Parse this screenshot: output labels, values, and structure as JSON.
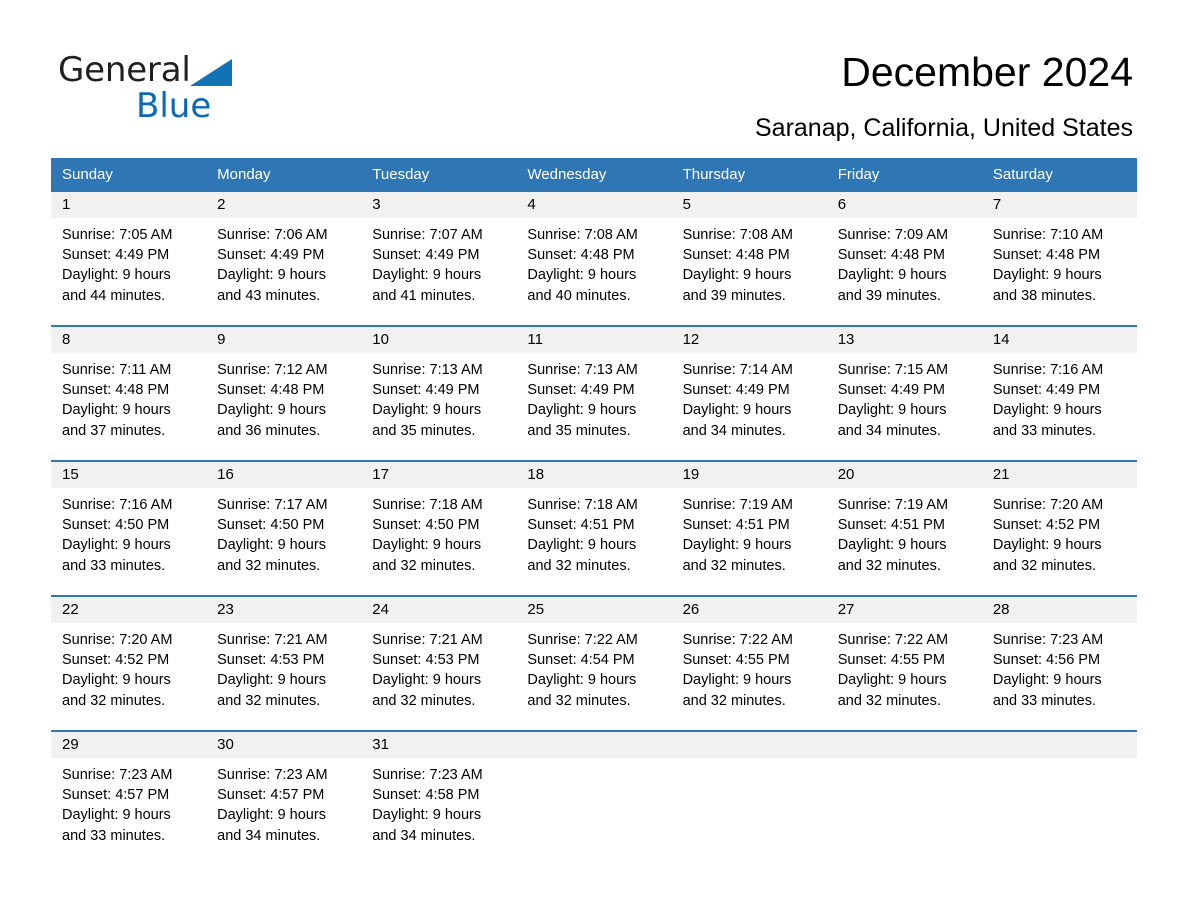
{
  "brand": {
    "name_part1": "General",
    "name_part2": "Blue",
    "triangle_color": "#1272b6",
    "blue_color": "#0b6ab5"
  },
  "header": {
    "title": "December 2024",
    "subtitle": "Saranap, California, United States"
  },
  "theme": {
    "header_blue": "#2f76b5",
    "date_band_gray": "#f1f1f1",
    "row_rule_blue": "#2f76b5",
    "text_black": "#000000",
    "header_text_white": "#ffffff"
  },
  "weekdays": [
    "Sunday",
    "Monday",
    "Tuesday",
    "Wednesday",
    "Thursday",
    "Friday",
    "Saturday"
  ],
  "weeks": [
    [
      {
        "date": "1",
        "sunrise": "Sunrise: 7:05 AM",
        "sunset": "Sunset: 4:49 PM",
        "daylight_line1": "Daylight: 9 hours",
        "daylight_line2": "and 44 minutes."
      },
      {
        "date": "2",
        "sunrise": "Sunrise: 7:06 AM",
        "sunset": "Sunset: 4:49 PM",
        "daylight_line1": "Daylight: 9 hours",
        "daylight_line2": "and 43 minutes."
      },
      {
        "date": "3",
        "sunrise": "Sunrise: 7:07 AM",
        "sunset": "Sunset: 4:49 PM",
        "daylight_line1": "Daylight: 9 hours",
        "daylight_line2": "and 41 minutes."
      },
      {
        "date": "4",
        "sunrise": "Sunrise: 7:08 AM",
        "sunset": "Sunset: 4:48 PM",
        "daylight_line1": "Daylight: 9 hours",
        "daylight_line2": "and 40 minutes."
      },
      {
        "date": "5",
        "sunrise": "Sunrise: 7:08 AM",
        "sunset": "Sunset: 4:48 PM",
        "daylight_line1": "Daylight: 9 hours",
        "daylight_line2": "and 39 minutes."
      },
      {
        "date": "6",
        "sunrise": "Sunrise: 7:09 AM",
        "sunset": "Sunset: 4:48 PM",
        "daylight_line1": "Daylight: 9 hours",
        "daylight_line2": "and 39 minutes."
      },
      {
        "date": "7",
        "sunrise": "Sunrise: 7:10 AM",
        "sunset": "Sunset: 4:48 PM",
        "daylight_line1": "Daylight: 9 hours",
        "daylight_line2": "and 38 minutes."
      }
    ],
    [
      {
        "date": "8",
        "sunrise": "Sunrise: 7:11 AM",
        "sunset": "Sunset: 4:48 PM",
        "daylight_line1": "Daylight: 9 hours",
        "daylight_line2": "and 37 minutes."
      },
      {
        "date": "9",
        "sunrise": "Sunrise: 7:12 AM",
        "sunset": "Sunset: 4:48 PM",
        "daylight_line1": "Daylight: 9 hours",
        "daylight_line2": "and 36 minutes."
      },
      {
        "date": "10",
        "sunrise": "Sunrise: 7:13 AM",
        "sunset": "Sunset: 4:49 PM",
        "daylight_line1": "Daylight: 9 hours",
        "daylight_line2": "and 35 minutes."
      },
      {
        "date": "11",
        "sunrise": "Sunrise: 7:13 AM",
        "sunset": "Sunset: 4:49 PM",
        "daylight_line1": "Daylight: 9 hours",
        "daylight_line2": "and 35 minutes."
      },
      {
        "date": "12",
        "sunrise": "Sunrise: 7:14 AM",
        "sunset": "Sunset: 4:49 PM",
        "daylight_line1": "Daylight: 9 hours",
        "daylight_line2": "and 34 minutes."
      },
      {
        "date": "13",
        "sunrise": "Sunrise: 7:15 AM",
        "sunset": "Sunset: 4:49 PM",
        "daylight_line1": "Daylight: 9 hours",
        "daylight_line2": "and 34 minutes."
      },
      {
        "date": "14",
        "sunrise": "Sunrise: 7:16 AM",
        "sunset": "Sunset: 4:49 PM",
        "daylight_line1": "Daylight: 9 hours",
        "daylight_line2": "and 33 minutes."
      }
    ],
    [
      {
        "date": "15",
        "sunrise": "Sunrise: 7:16 AM",
        "sunset": "Sunset: 4:50 PM",
        "daylight_line1": "Daylight: 9 hours",
        "daylight_line2": "and 33 minutes."
      },
      {
        "date": "16",
        "sunrise": "Sunrise: 7:17 AM",
        "sunset": "Sunset: 4:50 PM",
        "daylight_line1": "Daylight: 9 hours",
        "daylight_line2": "and 32 minutes."
      },
      {
        "date": "17",
        "sunrise": "Sunrise: 7:18 AM",
        "sunset": "Sunset: 4:50 PM",
        "daylight_line1": "Daylight: 9 hours",
        "daylight_line2": "and 32 minutes."
      },
      {
        "date": "18",
        "sunrise": "Sunrise: 7:18 AM",
        "sunset": "Sunset: 4:51 PM",
        "daylight_line1": "Daylight: 9 hours",
        "daylight_line2": "and 32 minutes."
      },
      {
        "date": "19",
        "sunrise": "Sunrise: 7:19 AM",
        "sunset": "Sunset: 4:51 PM",
        "daylight_line1": "Daylight: 9 hours",
        "daylight_line2": "and 32 minutes."
      },
      {
        "date": "20",
        "sunrise": "Sunrise: 7:19 AM",
        "sunset": "Sunset: 4:51 PM",
        "daylight_line1": "Daylight: 9 hours",
        "daylight_line2": "and 32 minutes."
      },
      {
        "date": "21",
        "sunrise": "Sunrise: 7:20 AM",
        "sunset": "Sunset: 4:52 PM",
        "daylight_line1": "Daylight: 9 hours",
        "daylight_line2": "and 32 minutes."
      }
    ],
    [
      {
        "date": "22",
        "sunrise": "Sunrise: 7:20 AM",
        "sunset": "Sunset: 4:52 PM",
        "daylight_line1": "Daylight: 9 hours",
        "daylight_line2": "and 32 minutes."
      },
      {
        "date": "23",
        "sunrise": "Sunrise: 7:21 AM",
        "sunset": "Sunset: 4:53 PM",
        "daylight_line1": "Daylight: 9 hours",
        "daylight_line2": "and 32 minutes."
      },
      {
        "date": "24",
        "sunrise": "Sunrise: 7:21 AM",
        "sunset": "Sunset: 4:53 PM",
        "daylight_line1": "Daylight: 9 hours",
        "daylight_line2": "and 32 minutes."
      },
      {
        "date": "25",
        "sunrise": "Sunrise: 7:22 AM",
        "sunset": "Sunset: 4:54 PM",
        "daylight_line1": "Daylight: 9 hours",
        "daylight_line2": "and 32 minutes."
      },
      {
        "date": "26",
        "sunrise": "Sunrise: 7:22 AM",
        "sunset": "Sunset: 4:55 PM",
        "daylight_line1": "Daylight: 9 hours",
        "daylight_line2": "and 32 minutes."
      },
      {
        "date": "27",
        "sunrise": "Sunrise: 7:22 AM",
        "sunset": "Sunset: 4:55 PM",
        "daylight_line1": "Daylight: 9 hours",
        "daylight_line2": "and 32 minutes."
      },
      {
        "date": "28",
        "sunrise": "Sunrise: 7:23 AM",
        "sunset": "Sunset: 4:56 PM",
        "daylight_line1": "Daylight: 9 hours",
        "daylight_line2": "and 33 minutes."
      }
    ],
    [
      {
        "date": "29",
        "sunrise": "Sunrise: 7:23 AM",
        "sunset": "Sunset: 4:57 PM",
        "daylight_line1": "Daylight: 9 hours",
        "daylight_line2": "and 33 minutes."
      },
      {
        "date": "30",
        "sunrise": "Sunrise: 7:23 AM",
        "sunset": "Sunset: 4:57 PM",
        "daylight_line1": "Daylight: 9 hours",
        "daylight_line2": "and 34 minutes."
      },
      {
        "date": "31",
        "sunrise": "Sunrise: 7:23 AM",
        "sunset": "Sunset: 4:58 PM",
        "daylight_line1": "Daylight: 9 hours",
        "daylight_line2": "and 34 minutes."
      },
      {
        "date": "",
        "sunrise": "",
        "sunset": "",
        "daylight_line1": "",
        "daylight_line2": ""
      },
      {
        "date": "",
        "sunrise": "",
        "sunset": "",
        "daylight_line1": "",
        "daylight_line2": ""
      },
      {
        "date": "",
        "sunrise": "",
        "sunset": "",
        "daylight_line1": "",
        "daylight_line2": ""
      },
      {
        "date": "",
        "sunrise": "",
        "sunset": "",
        "daylight_line1": "",
        "daylight_line2": ""
      }
    ]
  ]
}
